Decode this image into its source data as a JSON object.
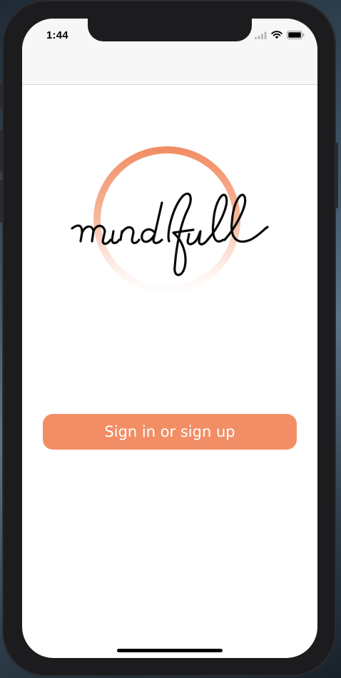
{
  "status_bar": {
    "time": "1:44",
    "icons": [
      "signal-icon",
      "wifi-icon",
      "battery-icon"
    ]
  },
  "logo": {
    "text": "mindfull",
    "ring_color": "#f28e65"
  },
  "auth": {
    "signin_label": "Sign in or sign up",
    "button_color": "#f28e65"
  }
}
